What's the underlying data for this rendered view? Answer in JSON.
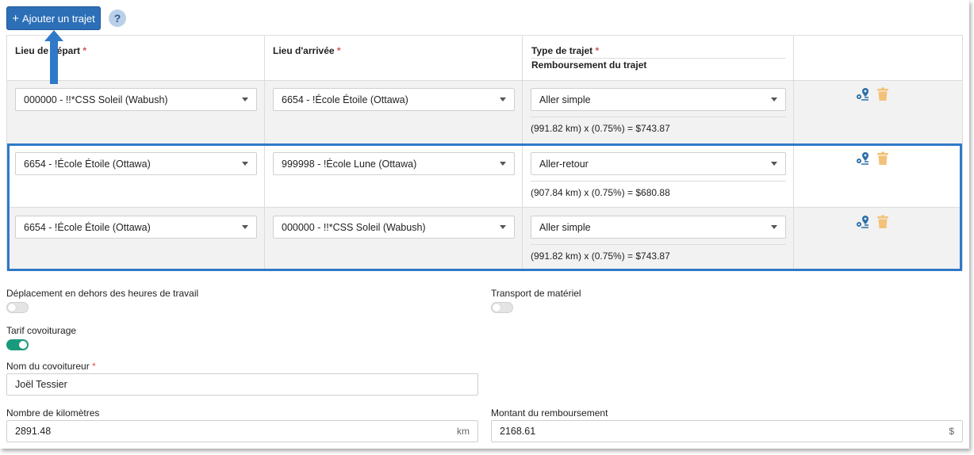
{
  "toolbar": {
    "add_button_label": "Ajouter un trajet",
    "add_icon": "plus-icon",
    "help_label": "?"
  },
  "table": {
    "headers": {
      "departure": "Lieu de départ",
      "arrival": "Lieu d'arrivée",
      "trip_type": "Type de trajet",
      "reimbursement": "Remboursement du trajet",
      "required_mark": "*"
    },
    "rows": [
      {
        "departure": "000000 - !!*CSS Soleil (Wabush)",
        "arrival": "6654 - !École Étoile (Ottawa)",
        "trip_type": "Aller simple",
        "calc": "(991.82 km) x (0.75%) = $743.87"
      },
      {
        "departure": "6654 - !École Étoile (Ottawa)",
        "arrival": "999998 - !École Lune (Ottawa)",
        "trip_type": "Aller-retour",
        "calc": "(907.84 km) x (0.75%) = $680.88"
      },
      {
        "departure": "6654 - !École Étoile (Ottawa)",
        "arrival": "000000 - !!*CSS Soleil (Wabush)",
        "trip_type": "Aller simple",
        "calc": "(991.82 km) x (0.75%) = $743.87"
      }
    ],
    "row_icons": [
      "route-map-icon",
      "trash-icon"
    ]
  },
  "form": {
    "outside_hours_label": "Déplacement en dehors des heures de travail",
    "outside_hours_on": false,
    "material_transport_label": "Transport de matériel",
    "material_transport_on": false,
    "carpool_label": "Tarif covoiturage",
    "carpool_on": true,
    "carpooler_name_label": "Nom du covoitureur",
    "carpooler_name_value": "Joël Tessier",
    "km_label": "Nombre de kilomètres",
    "km_value": "2891.48",
    "km_suffix": "km",
    "amount_label": "Montant du remboursement",
    "amount_value": "2168.61",
    "amount_suffix": "$"
  },
  "colors": {
    "primary": "#2c6fb7",
    "highlight": "#2f79c8",
    "toggle_on": "#1a9a7c",
    "icon_blue": "#2a6fa8",
    "icon_trash": "#f2c27a",
    "required": "#d9534f"
  }
}
